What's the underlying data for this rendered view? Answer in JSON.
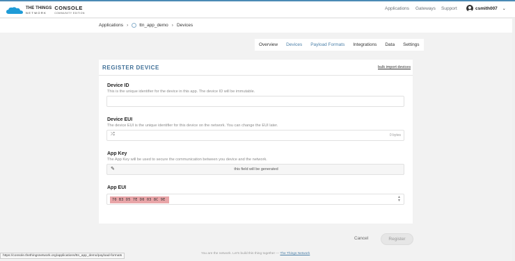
{
  "header": {
    "logo_line1": "THE THINGS",
    "logo_line2": "NETWORK",
    "console_title": "CONSOLE",
    "console_edition": "COMMUNITY EDITION",
    "nav": [
      "Applications",
      "Gateways",
      "Support"
    ],
    "username": "csmith007",
    "caret": "⌄"
  },
  "breadcrumb": {
    "items": [
      "Applications",
      "ttn_app_demo",
      "Devices"
    ],
    "separator": "›"
  },
  "tabs": [
    "Overview",
    "Devices",
    "Payload Formats",
    "Integrations",
    "Data",
    "Settings"
  ],
  "card": {
    "title": "REGISTER DEVICE",
    "bulk_link": "bulk import devices",
    "fields": {
      "device_id": {
        "label": "Device ID",
        "help": "This is the unique identifier for the device in this app. The device ID will be immutable.",
        "value": ""
      },
      "device_eui": {
        "label": "Device EUI",
        "help": "The device EUI is the unique identifier for this device on the network. You can change the EUI later.",
        "bytes": "0 bytes"
      },
      "app_key": {
        "label": "App Key",
        "help": "The App Key will be used to secure the communication between you device and the network.",
        "generated": "this field will be generated"
      },
      "app_eui": {
        "label": "App EUI",
        "value": "70 B3 D5 7E D0 03 8C 9E"
      }
    }
  },
  "actions": {
    "cancel": "Cancel",
    "register": "Register"
  },
  "footer": {
    "text": "You are the network. Let's build this thing together —",
    "link": "The Things Network"
  },
  "status_url": "https://console.thethingsnetwork.org/applications/ttn_app_demo/payload-formats",
  "colors": {
    "accent": "#3f6f97",
    "link": "#4a7fa8",
    "highlight": "#e9a5a8"
  }
}
